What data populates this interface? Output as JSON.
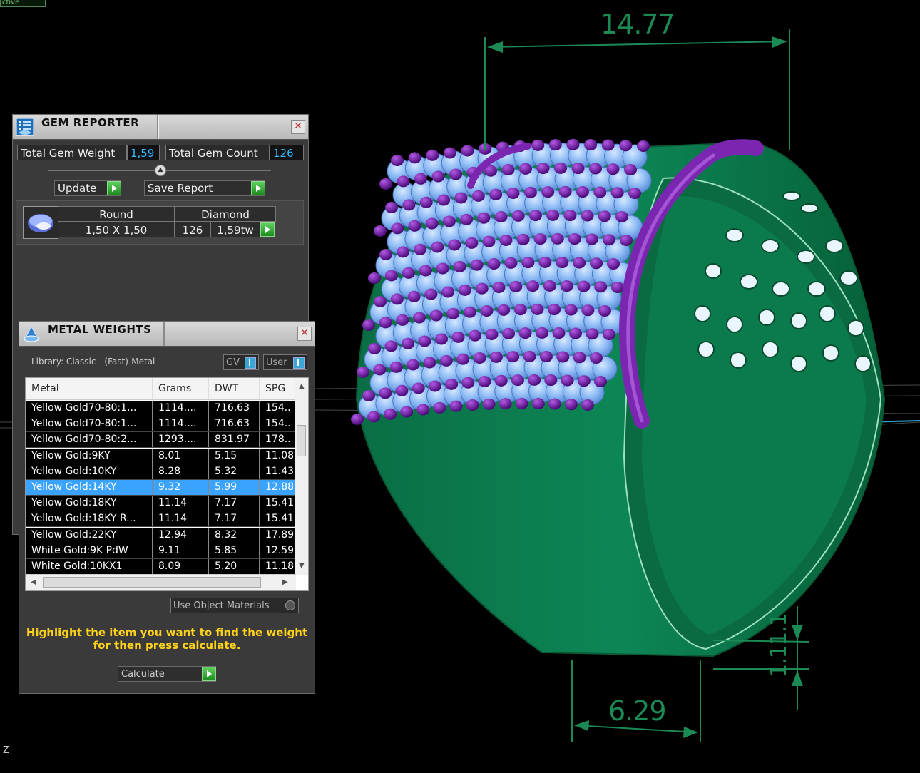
{
  "viewport": {
    "tab_label": "ctive",
    "axis_label": "Z",
    "dimensions": {
      "top_width": "14.77",
      "bottom_width": "6.29",
      "thickness_1": "1.1",
      "thickness_2": "1.1"
    },
    "colors": {
      "ring": "#0c7a4e",
      "gems": "#7fb3f5",
      "prongs": "#6a1a9e",
      "dimension": "#1c8a54"
    }
  },
  "gem_reporter": {
    "title": "GEM REPORTER",
    "total_gem_weight_label": "Total Gem Weight",
    "total_gem_weight": "1,59",
    "total_gem_count_label": "Total Gem Count",
    "total_gem_count": "126",
    "update_label": "Update",
    "save_report_label": "Save Report",
    "gem": {
      "shape": "Round",
      "material": "Diamond",
      "size": "1,50 X 1,50",
      "count": "126",
      "weight": "1,59tw"
    }
  },
  "metal_weights": {
    "title": "METAL WEIGHTS",
    "library": "Library: Classic - (Fast)-Metal",
    "gv_label": "GV",
    "user_label": "User",
    "columns": [
      "Metal",
      "Grams",
      "DWT",
      "SPG"
    ],
    "rows": [
      [
        "Yellow Gold70-80:1...",
        "1114....",
        "716.63",
        "154.."
      ],
      [
        "Yellow Gold70-80:1...",
        "1114....",
        "716.63",
        "154.."
      ],
      [
        "Yellow Gold70-80:2...",
        "1293....",
        "831.97",
        "178.."
      ],
      [
        "Yellow Gold:9KY",
        "8.01",
        "5.15",
        "11.08"
      ],
      [
        "Yellow Gold:10KY",
        "8.28",
        "5.32",
        "11.43"
      ],
      [
        "Yellow Gold:14KY",
        "9.32",
        "5.99",
        "12.88"
      ],
      [
        "Yellow Gold:18KY",
        "11.14",
        "7.17",
        "15.41"
      ],
      [
        "Yellow Gold:18KY R...",
        "11.14",
        "7.17",
        "15.41"
      ],
      [
        "Yellow Gold:22KY",
        "12.94",
        "8.32",
        "17.89"
      ],
      [
        "White Gold:9K PdW",
        "9.11",
        "5.85",
        "12.59"
      ],
      [
        "White Gold:10KX1",
        "8.09",
        "5.20",
        "11.18"
      ]
    ],
    "selected_row": 5,
    "use_object_materials_label": "Use Object Materials",
    "hint_line1": "Highlight the item you want to find the weight",
    "hint_line2": "for then press calculate.",
    "calculate_label": "Calculate"
  }
}
